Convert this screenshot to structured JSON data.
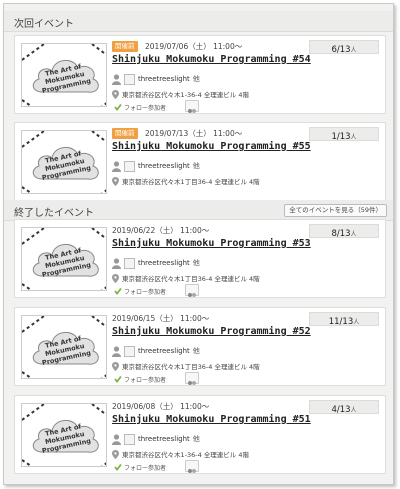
{
  "upcoming": {
    "title": "次回イベント",
    "events": [
      {
        "status": "開催前",
        "datetime": "2019/07/06（土） 11:00〜",
        "title": "Shinjuku Mokumoku Programming #54",
        "owner": "threetreeslight",
        "owner_suffix": "他",
        "address": "東京都渋谷区代々木1-36-4 全理連ビル 4階",
        "follow_label": "フォロー参加者",
        "participants": "6/13",
        "unit": "人"
      },
      {
        "status": "開催前",
        "datetime": "2019/07/13（土） 11:00〜",
        "title": "Shinjuku Mokumoku Programming #55",
        "owner": "threetreeslight",
        "owner_suffix": "他",
        "address": "東京都渋谷区代々木1丁目36-4 全理連ビル 4階",
        "follow_label": "",
        "participants": "1/13",
        "unit": "人"
      }
    ]
  },
  "past": {
    "title": "終了したイベント",
    "view_all_label": "全てのイベントを見る（59件）",
    "events": [
      {
        "status": "",
        "datetime": "2019/06/22（土） 11:00〜",
        "title": "Shinjuku Mokumoku Programming #53",
        "owner": "threetreeslight",
        "owner_suffix": "他",
        "address": "東京都渋谷区代々木1丁目36-4 全理連ビル 4階",
        "follow_label": "フォロー参加者",
        "participants": "8/13",
        "unit": "人"
      },
      {
        "status": "",
        "datetime": "2019/06/15（土） 11:00〜",
        "title": "Shinjuku Mokumoku Programming #52",
        "owner": "threetreeslight",
        "owner_suffix": "他",
        "address": "東京都渋谷区代々木1丁目36-4 全理連ビル 4階",
        "follow_label": "フォロー参加者",
        "participants": "11/13",
        "unit": "人"
      },
      {
        "status": "",
        "datetime": "2019/06/08（土） 11:00〜",
        "title": "Shinjuku Mokumoku Programming #51",
        "owner": "threetreeslight",
        "owner_suffix": "他",
        "address": "東京都渋谷区代々木1-36-4 全理連ビル 4階",
        "follow_label": "フォロー参加者",
        "participants": "4/13",
        "unit": "人"
      }
    ]
  },
  "thumbnail_text": [
    "The Art of",
    "Mokumoku",
    "Programming"
  ],
  "colors": {
    "badge": "#f0a040",
    "follow_check": "#7cb342",
    "frame_bg": "#f2f2f0"
  }
}
